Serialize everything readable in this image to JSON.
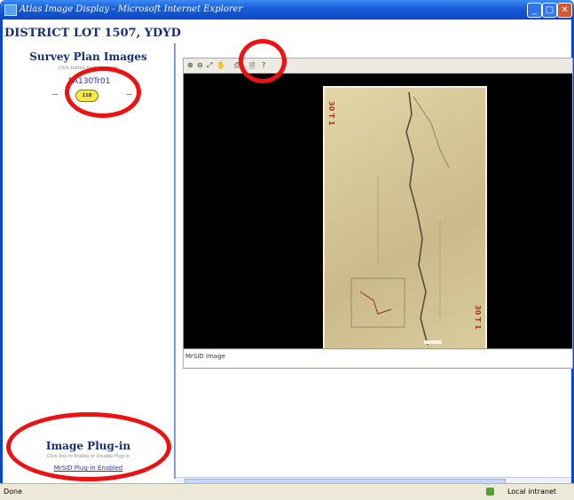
{
  "window": {
    "title": "Atlas Image Display - Microsoft Internet Explorer",
    "min": "_",
    "max": "□",
    "close": "✕"
  },
  "page": {
    "title": "DISTRICT LOT 1507, YDYD"
  },
  "left": {
    "survey_title": "Survey Plan Images",
    "survey_hint": "Click button to view image",
    "plan_link": "PA130Tr01",
    "plan_button": "118",
    "plugin_title": "Image Plug-in",
    "plugin_hint": "Click link to Enable or Disable Plug-in",
    "plugin_link": "MrSID Plug-in Enabled"
  },
  "viewer": {
    "toolbar": [
      "⊕",
      "⊖",
      "⤢",
      "✋",
      "⎙",
      "🗎",
      "?"
    ],
    "map_label_top": "30 T 1",
    "map_label_bottom": "30 T 1",
    "status_label": "MrSID Image"
  },
  "statusbar": {
    "left": "Done",
    "zone": "Local intranet"
  },
  "colors": {
    "title_blue": "#1a2c7c",
    "highlight_red": "#ee1111"
  }
}
